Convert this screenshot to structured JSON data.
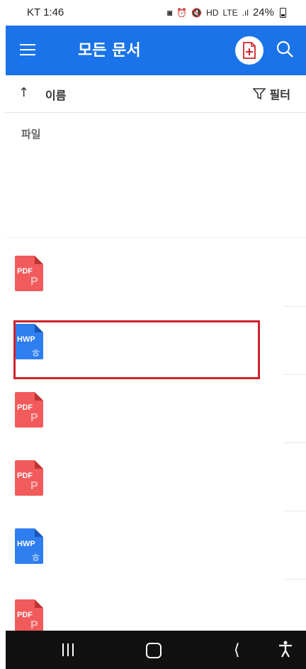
{
  "status_bar": {
    "carrier_time": "KT 1:46",
    "network": "LTE",
    "battery": "24%"
  },
  "app_bar": {
    "title": "모든 문서",
    "icons": [
      "menu-icon",
      "new-document-icon",
      "search-icon"
    ],
    "color": "#1a73e8"
  },
  "sort_bar": {
    "sort_label": "이름",
    "filter_label": "필터"
  },
  "section": {
    "label": "파일"
  },
  "files": [
    {
      "type": "PDF",
      "mark": "P",
      "color": "#f25b5b"
    },
    {
      "type": "HWP",
      "mark": "ㅎ",
      "color": "#2f7ef0"
    },
    {
      "type": "PDF",
      "mark": "P",
      "color": "#f25b5b"
    },
    {
      "type": "PDF",
      "mark": "P",
      "color": "#f25b5b"
    },
    {
      "type": "HWP",
      "mark": "ㅎ",
      "color": "#2f7ef0"
    },
    {
      "type": "PDF",
      "mark": "P",
      "color": "#f25b5b"
    }
  ],
  "highlight_color": "#d0222a"
}
